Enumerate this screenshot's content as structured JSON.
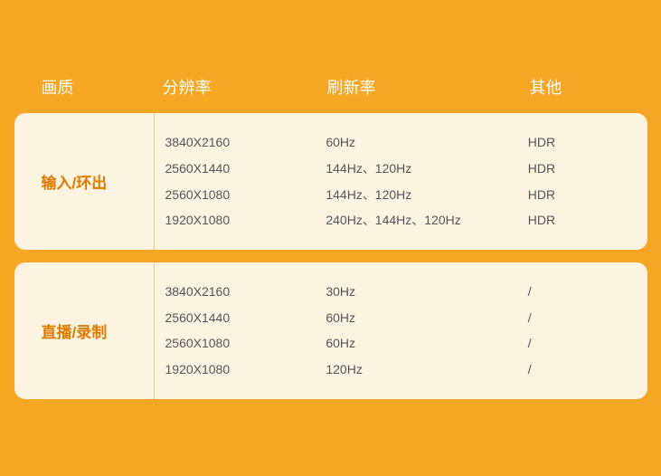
{
  "header": {
    "quality_label": "画质",
    "resolution_label": "分辨率",
    "refresh_label": "刷新率",
    "other_label": "其他"
  },
  "rows": [
    {
      "quality": "输入/环出",
      "entries": [
        {
          "resolution": "3840X2160",
          "refresh": "60Hz",
          "other": "HDR"
        },
        {
          "resolution": "2560X1440",
          "refresh": "144Hz、120Hz",
          "other": "HDR"
        },
        {
          "resolution": "2560X1080",
          "refresh": "144Hz、120Hz",
          "other": "HDR"
        },
        {
          "resolution": "1920X1080",
          "refresh": "240Hz、144Hz、120Hz",
          "other": "HDR"
        }
      ]
    },
    {
      "quality": "直播/录制",
      "entries": [
        {
          "resolution": "3840X2160",
          "refresh": "30Hz",
          "other": "/"
        },
        {
          "resolution": "2560X1440",
          "refresh": "60Hz",
          "other": "/"
        },
        {
          "resolution": "2560X1080",
          "refresh": "60Hz",
          "other": "/"
        },
        {
          "resolution": "1920X1080",
          "refresh": "120Hz",
          "other": "/"
        }
      ]
    }
  ],
  "colors": {
    "background": "#f5a623",
    "card_bg": "#fdf3e1",
    "header_text": "#ffffff",
    "quality_text": "#e07b00",
    "data_text": "#555555",
    "divider": "#e8c98a"
  }
}
